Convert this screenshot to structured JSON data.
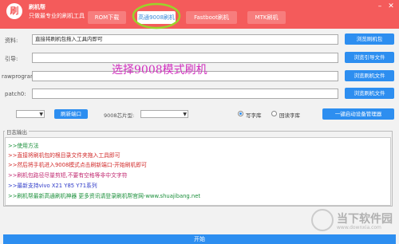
{
  "app": {
    "logo_char": "刷",
    "name": "刷机帮",
    "subtitle": "只做最专业的刷机工具"
  },
  "tabs": [
    {
      "label": "ROM下载"
    },
    {
      "label": "高通9008刷机"
    },
    {
      "label": "Fastboot刷机"
    },
    {
      "label": "MTK刷机"
    }
  ],
  "window": {
    "minimize": "–",
    "close": "✕"
  },
  "form": {
    "rows": [
      {
        "label": "资料:",
        "value": "直接将刷机包拖入工具内即可",
        "button": "浏览刷机包"
      },
      {
        "label": "引导:",
        "value": "",
        "button": "浏览引导文件"
      },
      {
        "label": "rawprogram:",
        "value": "",
        "button": "浏览刷机文件"
      },
      {
        "label": "patch0:",
        "value": "",
        "button": "浏览刷机文件"
      }
    ]
  },
  "annotation": "选择9008模式刷机",
  "controls": {
    "refresh_port": "刷新端口",
    "chip_label": "9008芯片型:",
    "radio_write": "写字库",
    "radio_read": "回读字库",
    "one_key": "一键启动设备管理器"
  },
  "log": {
    "title": "日志输出",
    "lines": [
      {
        "text": ">>使用方法",
        "color": "#1a8f3a"
      },
      {
        "text": ">>直接将刷机包的根目录文件夹拖入工具即可",
        "color": "#d12a2a"
      },
      {
        "text": ">>然后将手机进入9008模式点击刷新端口-开始刷机即可",
        "color": "#d12a2a"
      },
      {
        "text": ">>刷机包路径尽量剪短,不要有空格等非中文字符",
        "color": "#c0276f"
      },
      {
        "text": ">>最新支持vivo X21 Y85 Y71系列",
        "color": "#2d39c8"
      },
      {
        "text": ">>刷机帮最新高通刷机神器 更多资讯请登录刷机帮官网-www.shuajibang.net",
        "color": "#1a8f3a"
      }
    ]
  },
  "start_button": "开始",
  "watermark": {
    "text": "当下软件园",
    "url": "www.downxia.com"
  },
  "colors": {
    "title_bar": "#f45b5b",
    "accent": "#2d8ef0",
    "highlight_ring": "#9bd22a"
  }
}
